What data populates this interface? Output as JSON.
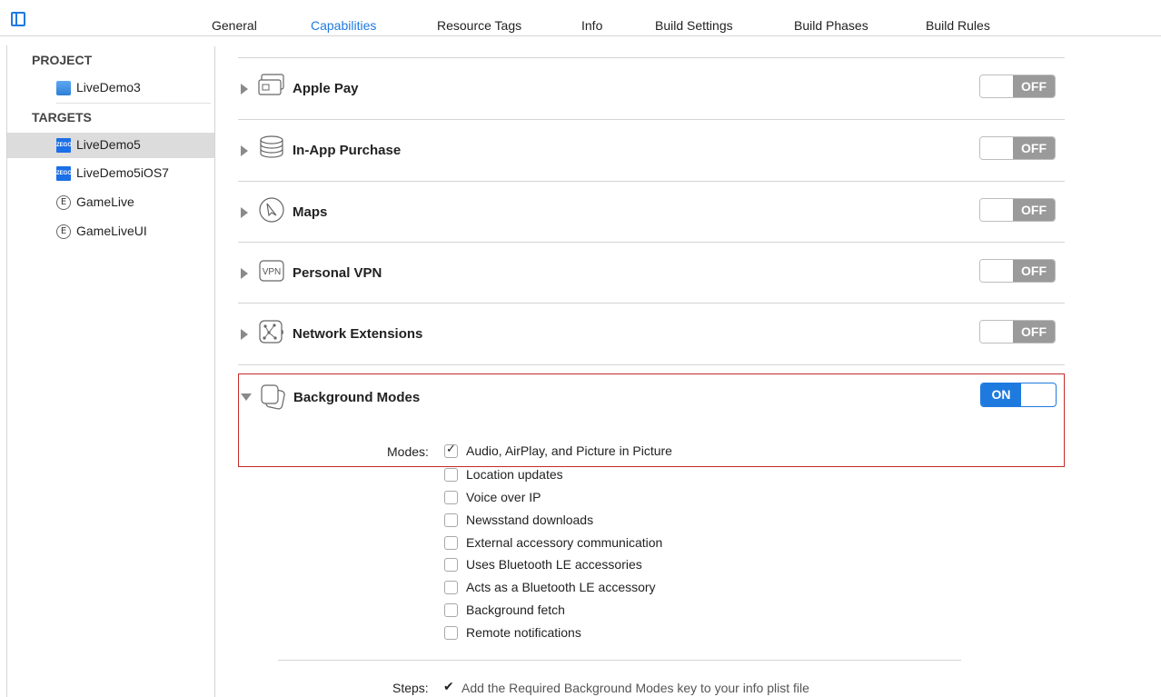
{
  "tabs": [
    {
      "label": "General"
    },
    {
      "label": "Capabilities",
      "active": true
    },
    {
      "label": "Resource Tags"
    },
    {
      "label": "Info"
    },
    {
      "label": "Build Settings"
    },
    {
      "label": "Build Phases"
    },
    {
      "label": "Build Rules"
    }
  ],
  "sidebar": {
    "project_header": "PROJECT",
    "project_item": "LiveDemo3",
    "targets_header": "TARGETS",
    "targets": [
      {
        "label": "LiveDemo5",
        "icon": "zego-app-icon",
        "selected": true
      },
      {
        "label": "LiveDemo5iOS7",
        "icon": "zego-app-icon"
      },
      {
        "label": "GameLive",
        "icon": "extension-icon",
        "badge": "E"
      },
      {
        "label": "GameLiveUI",
        "icon": "extension-icon",
        "badge": "E"
      }
    ],
    "zego_badge": "ZEGO"
  },
  "capabilities": [
    {
      "title": "Apple Pay",
      "state": "OFF",
      "icon": "apple-pay-icon"
    },
    {
      "title": "In-App Purchase",
      "state": "OFF",
      "icon": "in-app-purchase-icon"
    },
    {
      "title": "Maps",
      "state": "OFF",
      "icon": "maps-icon"
    },
    {
      "title": "Personal VPN",
      "state": "OFF",
      "icon": "vpn-icon",
      "icon_text": "VPN"
    },
    {
      "title": "Network Extensions",
      "state": "OFF",
      "icon": "network-extensions-icon"
    }
  ],
  "background_modes": {
    "title": "Background Modes",
    "state": "ON",
    "modes_label": "Modes:",
    "modes": [
      {
        "label": "Audio, AirPlay, and Picture in Picture",
        "checked": true
      },
      {
        "label": "Location updates",
        "checked": false
      },
      {
        "label": "Voice over IP",
        "checked": false
      },
      {
        "label": "Newsstand downloads",
        "checked": false
      },
      {
        "label": "External accessory communication",
        "checked": false
      },
      {
        "label": "Uses Bluetooth LE accessories",
        "checked": false
      },
      {
        "label": "Acts as a Bluetooth LE accessory",
        "checked": false
      },
      {
        "label": "Background fetch",
        "checked": false
      },
      {
        "label": "Remote notifications",
        "checked": false
      }
    ],
    "check_glyph": "✓"
  },
  "steps": {
    "label": "Steps:",
    "check_glyph": "✔",
    "text": "Add the Required Background Modes key to your info plist file"
  },
  "colors": {
    "accent": "#1f7ae0",
    "highlight_border": "#c52a2a",
    "toggle_off": "#9a9a9a"
  }
}
